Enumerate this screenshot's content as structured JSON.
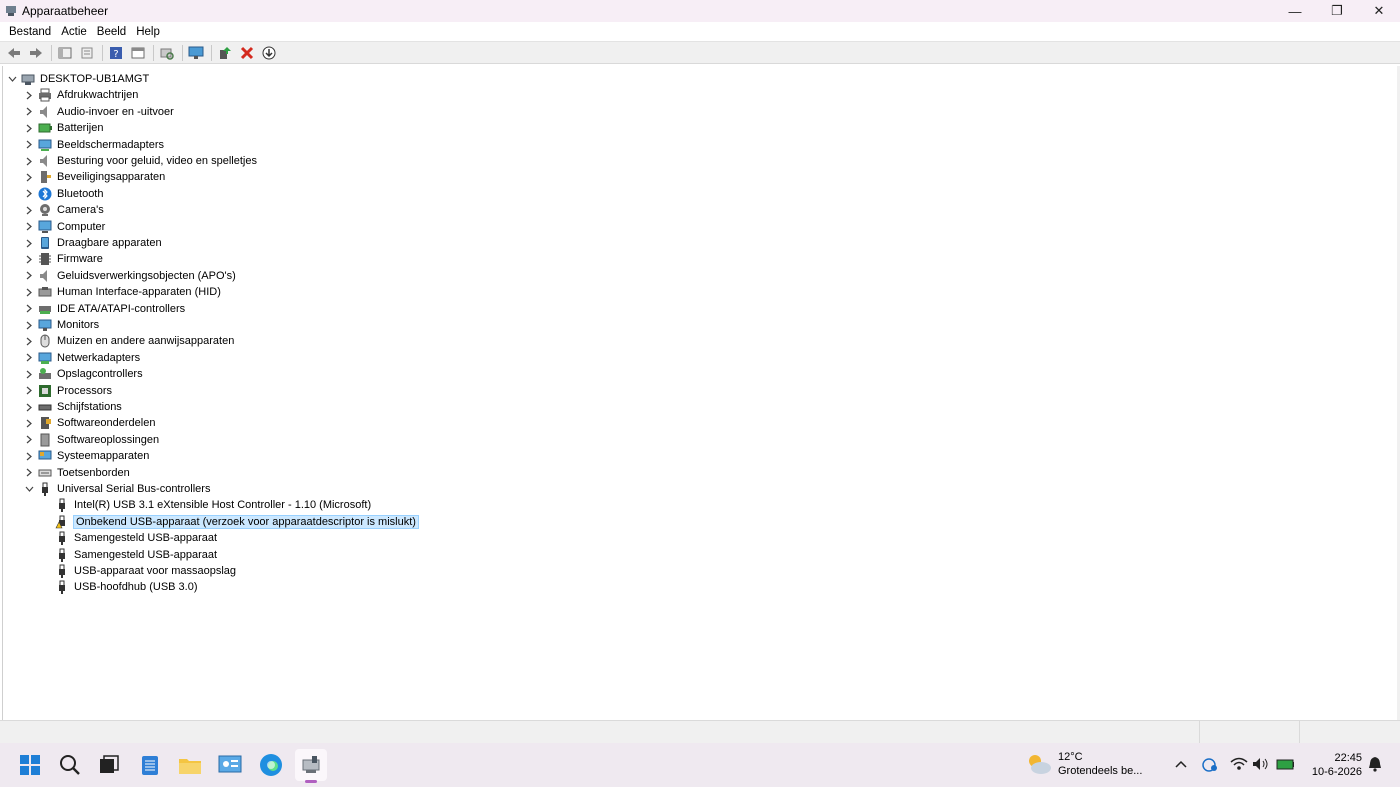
{
  "window": {
    "title": "Apparaatbeheer",
    "controls": {
      "minimize": "—",
      "restore": "❐",
      "close": "✕"
    }
  },
  "menu": [
    "Bestand",
    "Actie",
    "Beeld",
    "Help"
  ],
  "toolbar": [
    "back-icon",
    "forward-icon",
    "console-tree-icon",
    "properties-icon",
    "help-icon",
    "action-pane-icon",
    "scan-hardware-icon",
    "monitor-icon",
    "update-driver-icon",
    "uninstall-icon",
    "download-icon"
  ],
  "tree": {
    "root": "DESKTOP-UB1AMGT",
    "categories": [
      {
        "label": "Afdrukwachtrijen",
        "icon": "printer-icon"
      },
      {
        "label": "Audio-invoer en -uitvoer",
        "icon": "speaker-icon"
      },
      {
        "label": "Batterijen",
        "icon": "battery-icon"
      },
      {
        "label": "Beeldschermadapters",
        "icon": "display-adapter-icon"
      },
      {
        "label": "Besturing voor geluid, video en spelletjes",
        "icon": "speaker-icon"
      },
      {
        "label": "Beveiligingsapparaten",
        "icon": "security-key-icon"
      },
      {
        "label": "Bluetooth",
        "icon": "bluetooth-icon"
      },
      {
        "label": "Camera's",
        "icon": "camera-icon"
      },
      {
        "label": "Computer",
        "icon": "computer-icon"
      },
      {
        "label": "Draagbare apparaten",
        "icon": "portable-device-icon"
      },
      {
        "label": "Firmware",
        "icon": "firmware-icon"
      },
      {
        "label": "Geluidsverwerkingsobjecten (APO's)",
        "icon": "speaker-icon"
      },
      {
        "label": "Human Interface-apparaten (HID)",
        "icon": "hid-icon"
      },
      {
        "label": "IDE ATA/ATAPI-controllers",
        "icon": "ide-icon"
      },
      {
        "label": "Monitors",
        "icon": "monitor-icon"
      },
      {
        "label": "Muizen en andere aanwijsapparaten",
        "icon": "mouse-icon"
      },
      {
        "label": "Netwerkadapters",
        "icon": "network-icon"
      },
      {
        "label": "Opslagcontrollers",
        "icon": "storage-controller-icon"
      },
      {
        "label": "Processors",
        "icon": "processor-icon"
      },
      {
        "label": "Schijfstations",
        "icon": "disk-drive-icon"
      },
      {
        "label": "Softwareonderdelen",
        "icon": "software-component-icon"
      },
      {
        "label": "Softwareoplossingen",
        "icon": "software-device-icon"
      },
      {
        "label": "Systeemapparaten",
        "icon": "system-device-icon"
      },
      {
        "label": "Toetsenborden",
        "icon": "keyboard-icon"
      },
      {
        "label": "Universal Serial Bus-controllers",
        "icon": "usb-icon",
        "expanded": true
      }
    ],
    "usb_children": [
      {
        "label": "Intel(R) USB 3.1 eXtensible Host Controller - 1.10 (Microsoft)",
        "warning": false,
        "selected": false
      },
      {
        "label": "Onbekend USB-apparaat (verzoek voor apparaatdescriptor is mislukt)",
        "warning": true,
        "selected": true
      },
      {
        "label": "Samengesteld USB-apparaat",
        "warning": false,
        "selected": false
      },
      {
        "label": "Samengesteld USB-apparaat",
        "warning": false,
        "selected": false
      },
      {
        "label": "USB-apparaat voor massaopslag",
        "warning": false,
        "selected": false
      },
      {
        "label": "USB-hoofdhub (USB 3.0)",
        "warning": false,
        "selected": false
      }
    ]
  },
  "taskbar": {
    "apps": [
      "start-icon",
      "search-icon",
      "task-view-icon",
      "notepad-icon",
      "file-explorer-icon",
      "control-panel-icon",
      "edge-icon",
      "device-manager-icon"
    ],
    "active_app": "device-manager-icon",
    "weather": {
      "temp": "12°C",
      "desc": "Grotendeels be..."
    },
    "tray": [
      "chevron-up-icon",
      "onedrive-icon",
      "wifi-icon",
      "volume-icon",
      "battery-icon"
    ],
    "time": "22:45",
    "date": "10-6-2026"
  },
  "colors": {
    "selection_bg": "#cce8ff",
    "selection_border": "#99d1ff",
    "taskbar": "#efe9f0",
    "titlebar": "#f7eef6",
    "active_indicator": "#b05fc0"
  }
}
